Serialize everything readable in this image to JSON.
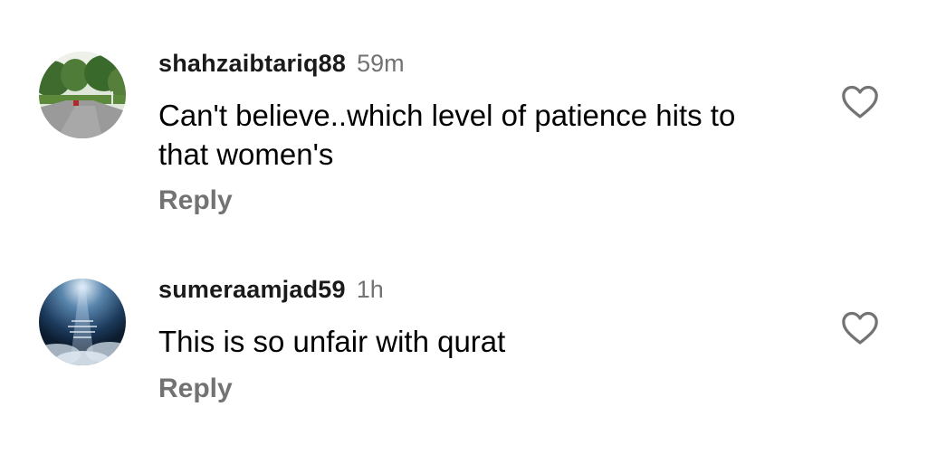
{
  "comments": [
    {
      "username": "shahzaibtariq88",
      "time": "59m",
      "text": "Can't believe..which level of patience hits to that women's",
      "reply_label": "Reply",
      "avatar_icon": "road-landscape-avatar",
      "like_icon": "heart-outline-icon"
    },
    {
      "username": "sumeraamjad59",
      "time": "1h",
      "text": "This is so unfair with qurat",
      "reply_label": "Reply",
      "avatar_icon": "sky-light-avatar",
      "like_icon": "heart-outline-icon"
    }
  ],
  "colors": {
    "meta_gray": "#737373",
    "text": "#000000",
    "background": "#ffffff"
  }
}
